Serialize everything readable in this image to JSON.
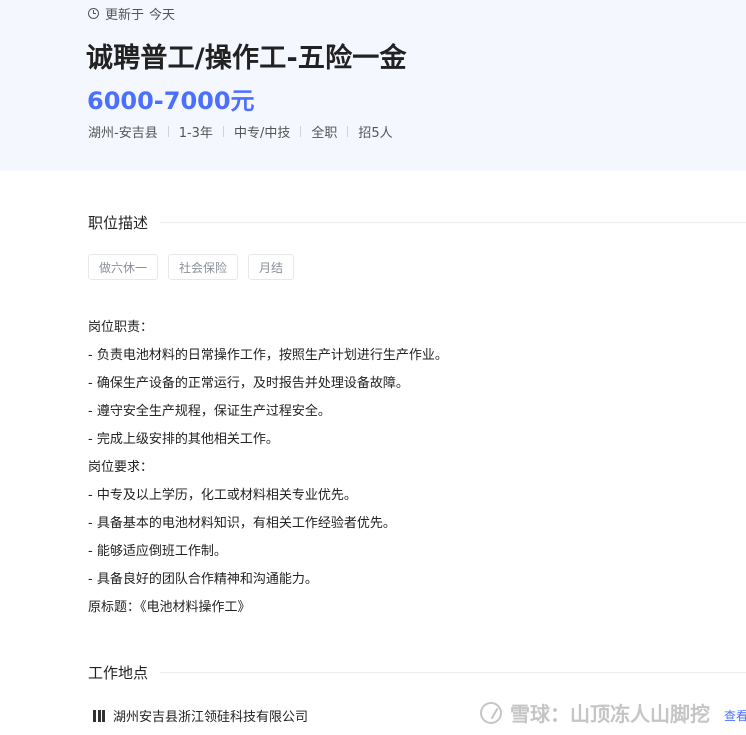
{
  "header": {
    "updated_label": "更新于",
    "updated_value": "今天",
    "job_title": "诚聘普工/操作工-五险一金",
    "salary": "6000-7000元",
    "meta": [
      "湖州-安吉县",
      "1-3年",
      "中专/中技",
      "全职",
      "招5人"
    ]
  },
  "description": {
    "heading": "职位描述",
    "tags": [
      "做六休一",
      "社会保险",
      "月结"
    ],
    "lines": [
      "岗位职责：",
      "- 负责电池材料的日常操作工作，按照生产计划进行生产作业。",
      "- 确保生产设备的正常运行，及时报告并处理设备故障。",
      "- 遵守安全生产规程，保证生产过程安全。",
      "- 完成上级安排的其他相关工作。",
      "岗位要求：",
      "- 中专及以上学历，化工或材料相关专业优先。",
      "- 具备基本的电池材料知识，有相关工作经验者优先。",
      "- 能够适应倒班工作制。",
      "- 具备良好的团队合作精神和沟通能力。",
      "原标题：《电池材料操作工》"
    ]
  },
  "location": {
    "heading": "工作地点",
    "company": "湖州安吉县浙江领硅科技有限公司",
    "view_link": "查看"
  },
  "watermark": {
    "text": "雪球：山顶冻人山脚挖"
  },
  "colors": {
    "accent": "#4c6fff",
    "hero_bg": "#f4f7fd"
  }
}
